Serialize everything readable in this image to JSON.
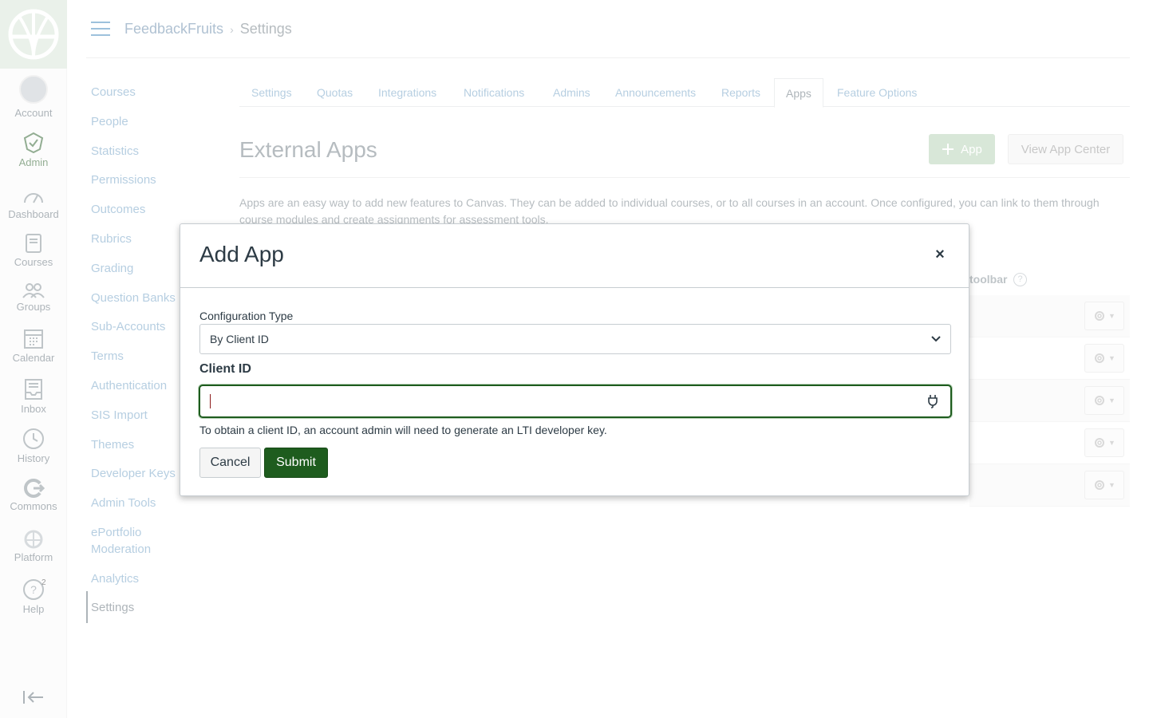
{
  "global_nav": {
    "account": "Account",
    "admin": "Admin",
    "dashboard": "Dashboard",
    "courses": "Courses",
    "groups": "Groups",
    "calendar": "Calendar",
    "inbox": "Inbox",
    "history": "History",
    "commons": "Commons",
    "platform": "Platform",
    "help": "Help",
    "help_badge": "2"
  },
  "breadcrumb": {
    "root": "FeedbackFruits",
    "separator": "›",
    "current": "Settings"
  },
  "left_nav": [
    "Courses",
    "People",
    "Statistics",
    "Permissions",
    "Outcomes",
    "Rubrics",
    "Grading",
    "Question Banks",
    "Sub-Accounts",
    "Terms",
    "Authentication",
    "SIS Import",
    "Themes",
    "Developer Keys",
    "Admin Tools",
    "ePortfolio",
    "Moderation",
    "Analytics",
    "Settings"
  ],
  "tabs": [
    "Settings",
    "Quotas",
    "Integrations",
    "Notifications",
    "Admins",
    "Announcements",
    "Reports",
    "Apps",
    "Feature Options"
  ],
  "main": {
    "title": "External Apps",
    "add_app": "App",
    "view_app_center": "View App Center",
    "description": "Apps are an easy way to add new features to Canvas. They can be added to individual courses, or to all courses in an account. Once configured, you can link to them through course modules and create assignments for assessment tools.",
    "toolbar_col": "toolbar",
    "help_q": "?"
  },
  "modal": {
    "title": "Add App",
    "close": "×",
    "config_label": "Configuration Type",
    "config_value": "By Client ID",
    "client_label": "Client ID",
    "client_value": "",
    "hint": "To obtain a client ID, an account admin will need to generate an LTI developer key.",
    "cancel": "Cancel",
    "submit": "Submit"
  },
  "colors": {
    "accent": "#1e5c1e",
    "link": "#7aa7c9"
  }
}
